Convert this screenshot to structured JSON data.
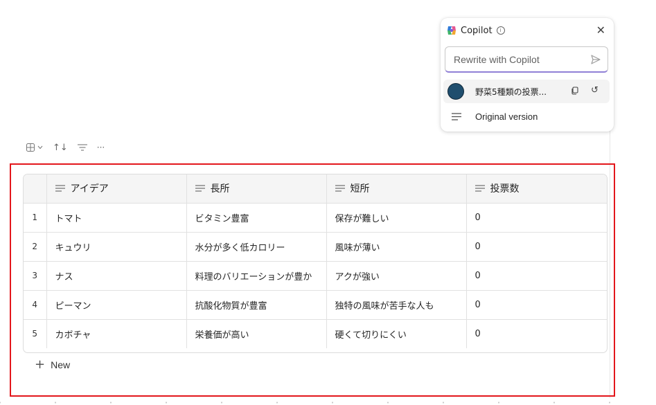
{
  "copilot": {
    "title": "Copilot",
    "rewrite_placeholder": "Rewrite with Copilot",
    "version_label": "野菜5種類の投票...",
    "original_label": "Original version",
    "info_glyph": "i",
    "close_glyph": "✕",
    "undo_glyph": "↺"
  },
  "toolbar": {
    "more_label": "···",
    "sort_glyph": "↑↓"
  },
  "table": {
    "columns": [
      {
        "label": "アイデア",
        "icon": "text-lines-icon"
      },
      {
        "label": "長所",
        "icon": "text-lines-icon"
      },
      {
        "label": "短所",
        "icon": "text-lines-icon"
      },
      {
        "label": "投票数",
        "icon": "text-lines-icon"
      }
    ],
    "rows": [
      {
        "num": "1",
        "idea": "トマト",
        "pros": "ビタミン豊富",
        "cons": "保存が難しい",
        "votes": "0"
      },
      {
        "num": "2",
        "idea": "キュウリ",
        "pros": "水分が多く低カロリー",
        "cons": "風味が薄い",
        "votes": "0"
      },
      {
        "num": "3",
        "idea": "ナス",
        "pros": "料理のバリエーションが豊か",
        "cons": "アクが強い",
        "votes": "0"
      },
      {
        "num": "4",
        "idea": "ピーマン",
        "pros": "抗酸化物質が豊富",
        "cons": "独特の風味が苦手な人も",
        "votes": "0"
      },
      {
        "num": "5",
        "idea": "カボチャ",
        "pros": "栄養価が高い",
        "cons": "硬くて切りにくい",
        "votes": "0"
      }
    ]
  },
  "new_row": {
    "plus_glyph": "+",
    "label": "New"
  },
  "colors": {
    "selection_frame": "#e3161b",
    "avatar": "#1f4e6e",
    "input_focus": "#8f7fd6"
  }
}
